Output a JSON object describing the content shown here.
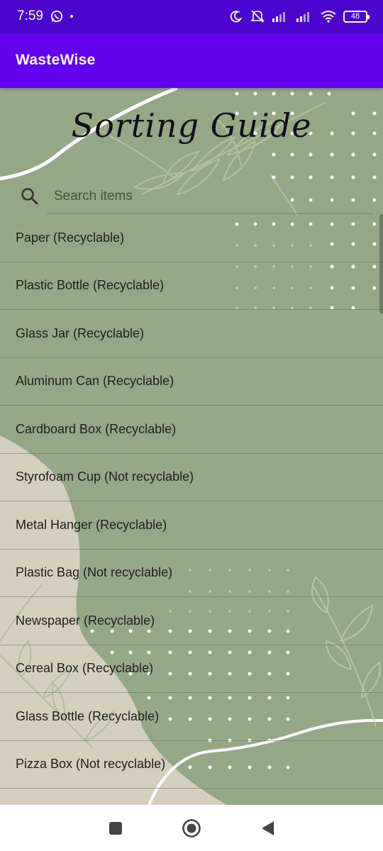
{
  "status": {
    "time": "7:59",
    "battery": "48"
  },
  "app_bar": {
    "title": "WasteWise"
  },
  "header": {
    "title": "Sorting Guide"
  },
  "search": {
    "placeholder": "Search items"
  },
  "items": [
    "Paper (Recyclable)",
    "Plastic Bottle (Recyclable)",
    "Glass Jar (Recyclable)",
    "Aluminum Can (Recyclable)",
    "Cardboard Box (Recyclable)",
    "Styrofoam Cup (Not recyclable)",
    "Metal Hanger (Recyclable)",
    "Plastic Bag (Not recyclable)",
    "Newspaper (Recyclable)",
    "Cereal Box (Recyclable)",
    "Glass Bottle (Recyclable)",
    "Pizza Box (Not recyclable)"
  ],
  "colors": {
    "status_bar": "#4a06cf",
    "app_bar": "#6200ee",
    "background_green": "#95a886",
    "background_beige": "#d4cfbd"
  },
  "icons": {
    "status": [
      "whatsapp-icon",
      "moon-icon",
      "mute-icon",
      "signal-icon",
      "wifi-icon",
      "battery-icon"
    ],
    "search": "search-icon",
    "nav": [
      "recents-icon",
      "home-icon",
      "back-icon"
    ]
  }
}
